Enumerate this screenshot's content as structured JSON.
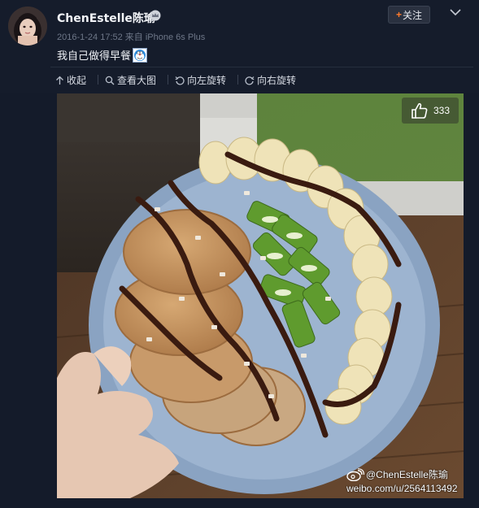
{
  "header": {
    "username": "ChenEstelle陈瑜",
    "follow_label": "关注",
    "follow_plus": "+",
    "timestamp": "2016-1-24 17:52",
    "source": "来自 iPhone 6s Plus",
    "post_text": "我自己做得早餐"
  },
  "toolbar": {
    "collapse_label": "收起",
    "view_large_label": "查看大图",
    "rotate_left_label": "向左旋转",
    "rotate_right_label": "向右旋转"
  },
  "photo": {
    "like_count": "333",
    "watermark_handle": "@ChenEstelle陈瑜",
    "watermark_url": "weibo.com/u/2564113492"
  },
  "colors": {
    "background": "#141b2a",
    "follow_plus": "#ff7a2b",
    "meta_text": "#6e7788"
  },
  "icons": [
    "crown-icon",
    "chevron-down-icon",
    "collapse-icon",
    "zoom-icon",
    "rotate-left-icon",
    "rotate-right-icon",
    "thumbs-up-icon",
    "weibo-logo-icon",
    "doraemon-emoji-icon"
  ]
}
